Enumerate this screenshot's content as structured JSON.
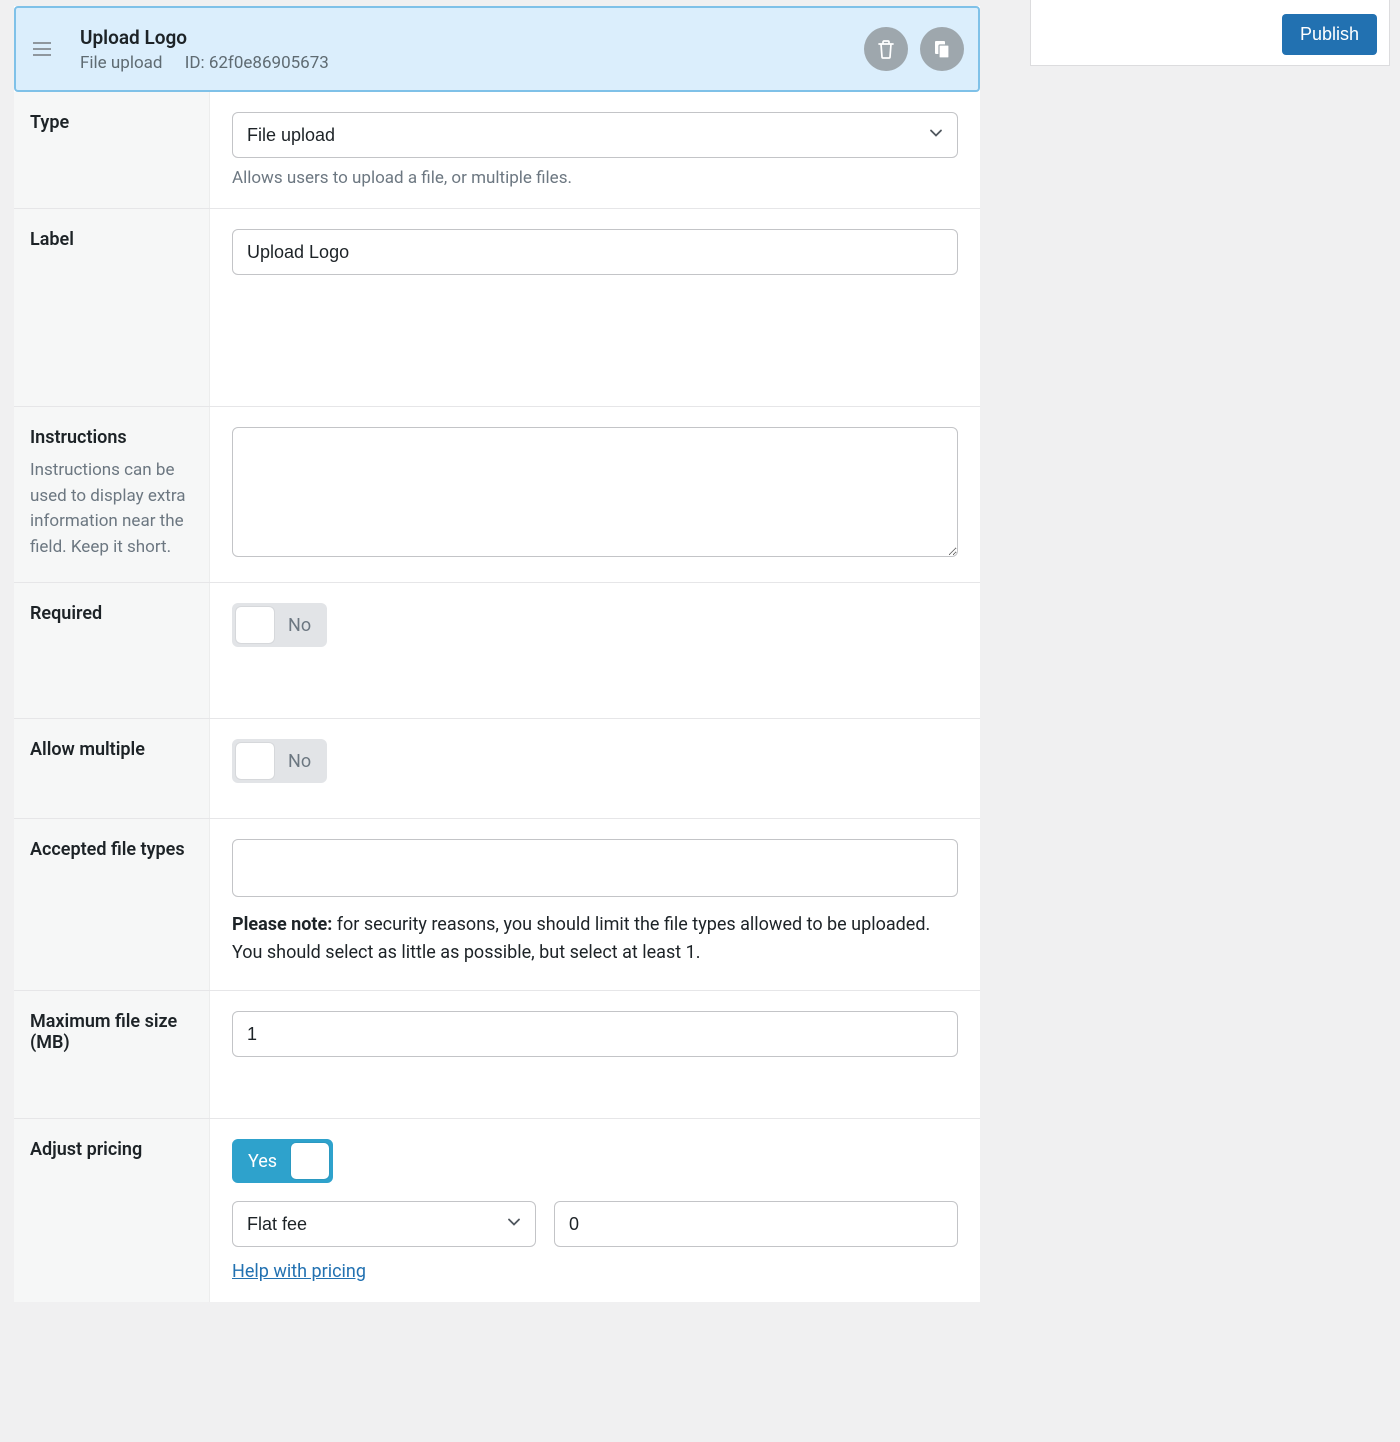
{
  "header": {
    "title": "Upload Logo",
    "subtype": "File upload",
    "id_label": "ID: 62f0e86905673"
  },
  "sidebar": {
    "publish": "Publish"
  },
  "labels": {
    "type": "Type",
    "label": "Label",
    "instructions": "Instructions",
    "instructions_help": "Instructions can be used to display extra information near the field. Keep it short.",
    "required": "Required",
    "allow_multiple": "Allow multiple",
    "accepted_types": "Accepted file types",
    "max_file_size": "Maximum file size (MB)",
    "adjust_pricing": "Adjust pricing"
  },
  "fields": {
    "type_value": "File upload",
    "type_help": "Allows users to upload a file, or multiple files.",
    "label_value": "Upload Logo",
    "instructions_value": "",
    "required_state": "No",
    "allow_multiple_state": "No",
    "accepted_types_note_bold": "Please note:",
    "accepted_types_note_rest": " for security reasons, you should limit the file types allowed to be uploaded. You should select as little as possible, but select at least 1.",
    "max_file_size_value": "1",
    "adjust_pricing_state": "Yes",
    "pricing_mode": "Flat fee",
    "pricing_amount": "0",
    "help_link": "Help with pricing"
  }
}
